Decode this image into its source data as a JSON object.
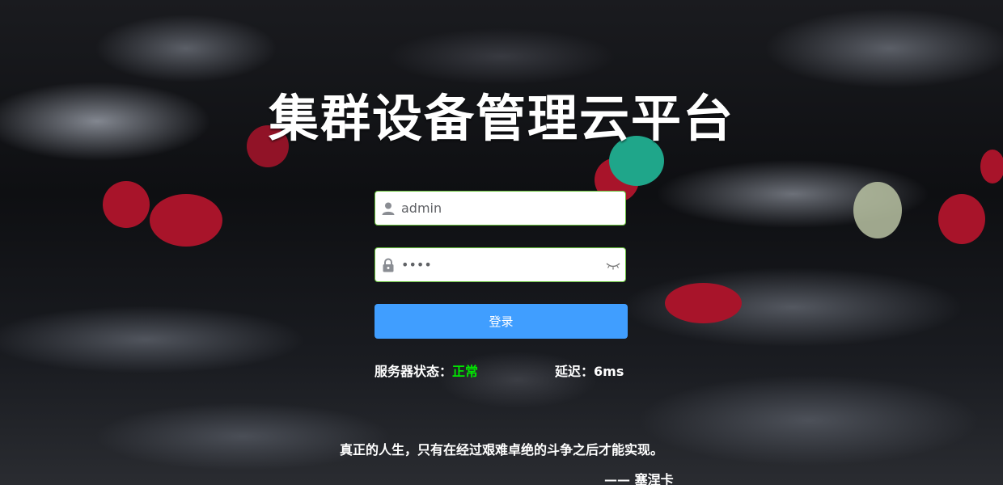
{
  "title": "集群设备管理云平台",
  "form": {
    "username_value": "admin",
    "username_icon": "user-icon",
    "password_value": "1234",
    "password_icon": "lock-icon",
    "password_toggle_icon": "eye-closed-icon",
    "login_label": "登录"
  },
  "status": {
    "server_label": "服务器状态：",
    "server_value": "正常",
    "latency_label": "延迟：",
    "latency_value": "6ms"
  },
  "quote": {
    "text": "真正的人生，只有在经过艰难卓绝的斗争之后才能实现。",
    "author": "—— 塞涅卡"
  },
  "colors": {
    "accent": "#409eff",
    "border_ok": "#67c23a",
    "status_ok": "#00e600"
  }
}
